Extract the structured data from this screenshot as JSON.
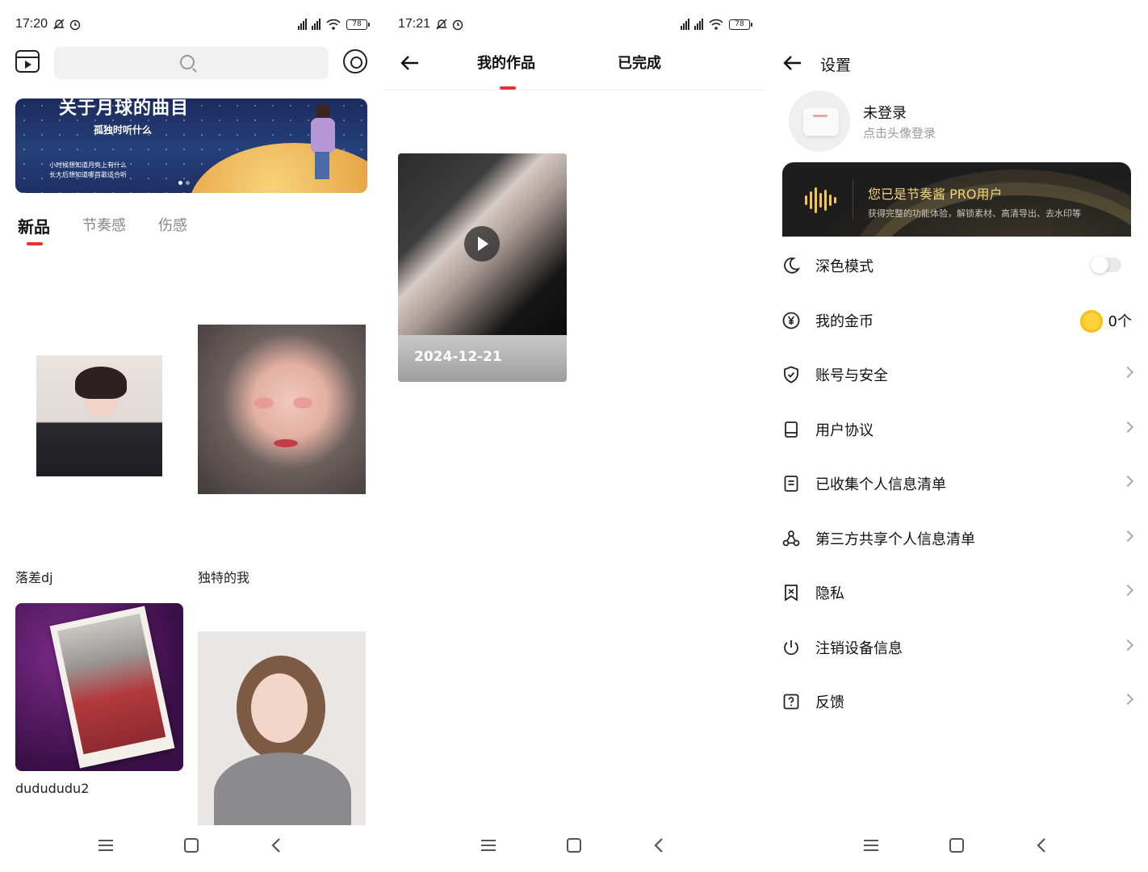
{
  "panel1": {
    "status": {
      "time": "17:20",
      "battery": "78"
    },
    "banner": {
      "title": "关于月球的曲目",
      "subtitle": "孤独时听什么",
      "line1": "小时候想知道月亮上有什么",
      "line2": "长大后想知道哪首歌适合听"
    },
    "tabs": [
      "新品",
      "节奏感",
      "伤感"
    ],
    "items": [
      {
        "label": "落差dj"
      },
      {
        "label": "独特的我"
      },
      {
        "label": "dudududu2"
      }
    ]
  },
  "panel2": {
    "status": {
      "time": "17:21",
      "battery": "78"
    },
    "tabs": [
      "我的作品",
      "已完成"
    ],
    "work": {
      "date": "2024-12-21"
    }
  },
  "panel3": {
    "title": "设置",
    "user": {
      "name": "未登录",
      "hint": "点击头像登录"
    },
    "pro": {
      "title": "您已是节奏酱 PRO用户",
      "desc": "获得完整的功能体验，解锁素材、高清导出、去水印等"
    },
    "settings": [
      {
        "label": "深色模式",
        "icon": "moon-icon"
      },
      {
        "label": "我的金币",
        "icon": "coin-yen-icon"
      },
      {
        "label": "账号与安全",
        "icon": "shield-check-icon"
      },
      {
        "label": "用户协议",
        "icon": "book-icon"
      },
      {
        "label": "已收集个人信息清单",
        "icon": "document-list-icon"
      },
      {
        "label": "第三方共享个人信息清单",
        "icon": "share-network-icon"
      },
      {
        "label": "隐私",
        "icon": "bookmark-x-icon"
      },
      {
        "label": "注销设备信息",
        "icon": "power-icon"
      },
      {
        "label": "反馈",
        "icon": "question-icon"
      }
    ],
    "coins": "0个",
    "dark_mode_on": false
  },
  "colors": {
    "accent": "#e5332f",
    "pro_gold": "#f3c646",
    "pro_bg": "#1d1d1d"
  }
}
